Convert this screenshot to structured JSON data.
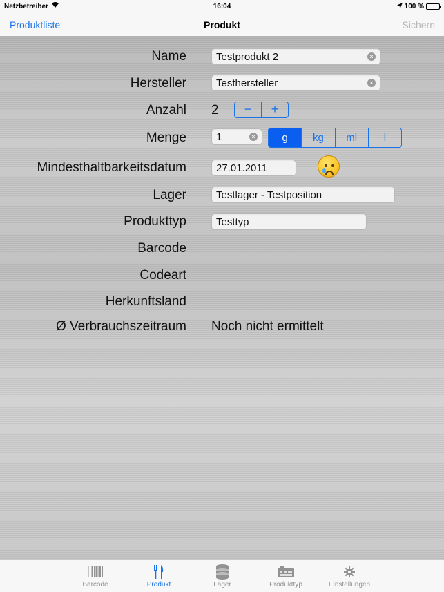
{
  "status_bar": {
    "carrier": "Netzbetreiber",
    "time": "16:04",
    "battery": "100 %"
  },
  "nav": {
    "back_label": "Produktliste",
    "title": "Produkt",
    "save_label": "Sichern"
  },
  "form": {
    "name": {
      "label": "Name",
      "value": "Testprodukt 2"
    },
    "hersteller": {
      "label": "Hersteller",
      "value": "Testhersteller"
    },
    "anzahl": {
      "label": "Anzahl",
      "value": "2",
      "minus": "−",
      "plus": "+"
    },
    "menge": {
      "label": "Menge",
      "value": "1",
      "units": [
        "g",
        "kg",
        "ml",
        "l"
      ],
      "selected_unit": "g"
    },
    "mhd": {
      "label": "Mindesthaltbarkeitsdatum",
      "value": "27.01.2011",
      "status_icon": "crying-face-icon"
    },
    "lager": {
      "label": "Lager",
      "value": "Testlager - Testposition"
    },
    "produkttyp": {
      "label": "Produkttyp",
      "value": "Testtyp"
    },
    "barcode": {
      "label": "Barcode",
      "value": ""
    },
    "codeart": {
      "label": "Codeart",
      "value": ""
    },
    "herkunftsland": {
      "label": "Herkunftsland",
      "value": ""
    },
    "verbrauchszeitraum": {
      "label": "Ø Verbrauchszeitraum",
      "value": "Noch nicht ermittelt"
    }
  },
  "tabs": [
    {
      "label": "Barcode",
      "icon": "barcode-icon",
      "active": false
    },
    {
      "label": "Produkt",
      "icon": "fork-knife-icon",
      "active": true
    },
    {
      "label": "Lager",
      "icon": "database-icon",
      "active": false
    },
    {
      "label": "Produkttyp",
      "icon": "register-icon",
      "active": false
    },
    {
      "label": "Einstellungen",
      "icon": "gear-icon",
      "active": false
    }
  ],
  "colors": {
    "accent": "#1a73e8",
    "segment_active": "#0a5ff0",
    "disabled": "#b8b8b8"
  }
}
